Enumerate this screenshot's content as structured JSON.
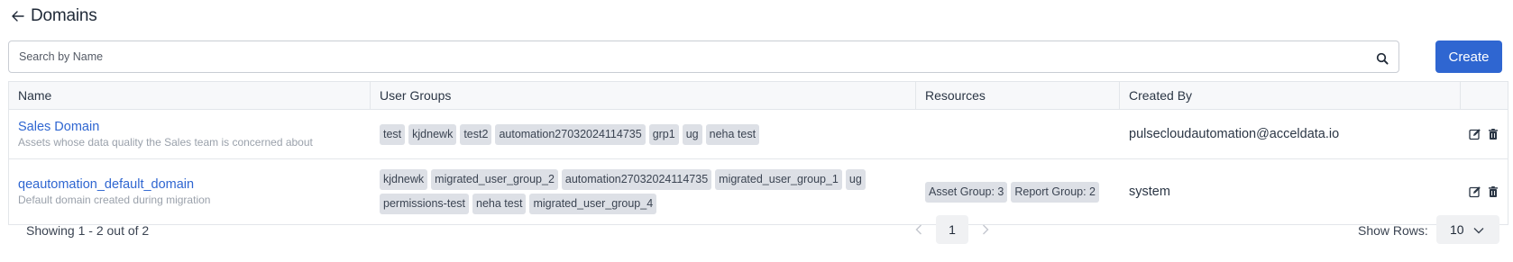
{
  "header": {
    "title": "Domains"
  },
  "search": {
    "placeholder": "Search by Name",
    "value": ""
  },
  "toolbar": {
    "create_label": "Create"
  },
  "table": {
    "columns": [
      "Name",
      "User Groups",
      "Resources",
      "Created By"
    ],
    "rows": [
      {
        "name": "Sales Domain",
        "description": "Assets whose data quality the Sales team is concerned about",
        "user_groups": [
          "test",
          "kjdnewk",
          "test2",
          "automation27032024114735",
          "grp1",
          "ug",
          "neha test"
        ],
        "resources": [],
        "created_by": "pulsecloudautomation@acceldata.io"
      },
      {
        "name": "qeautomation_default_domain",
        "description": "Default domain created during migration",
        "user_groups": [
          "kjdnewk",
          "migrated_user_group_2",
          "automation27032024114735",
          "migrated_user_group_1",
          "ug",
          "permissions-test",
          "neha test",
          "migrated_user_group_4"
        ],
        "resources": [
          "Asset Group: 3",
          "Report Group: 2"
        ],
        "created_by": "system"
      }
    ]
  },
  "pagination": {
    "showing_text": "Showing 1 - 2 out of 2",
    "current_page": "1",
    "rows_label": "Show Rows:",
    "rows_value": "10"
  },
  "icons": {
    "back": "arrow-left-icon",
    "search": "search-icon",
    "edit": "edit-icon",
    "delete": "trash-icon",
    "prev": "chevron-left-icon",
    "next": "chevron-right-icon",
    "dropdown": "chevron-down-icon"
  },
  "colors": {
    "accent": "#2f66d1",
    "chip_bg": "#dde0e6",
    "muted": "#9aa1ab"
  }
}
